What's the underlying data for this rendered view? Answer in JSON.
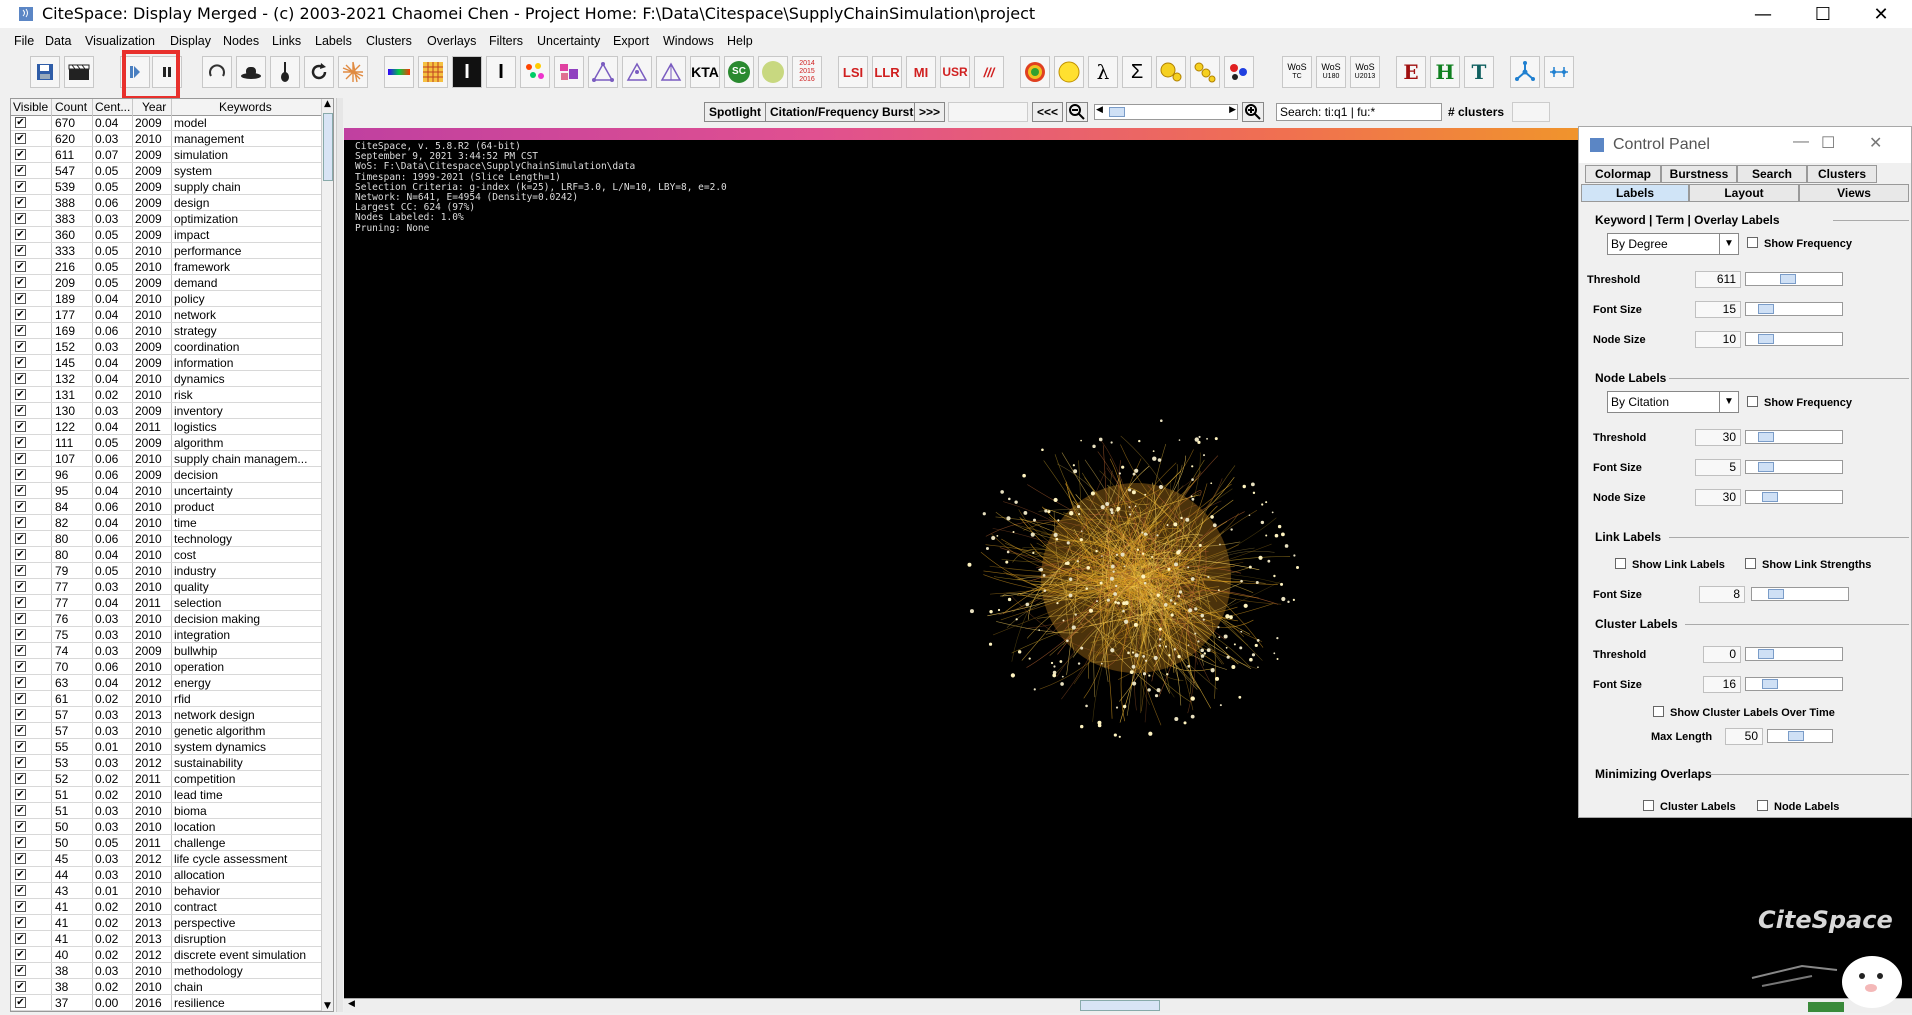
{
  "window": {
    "title": "CiteSpace: Display Merged - (c) 2003-2021 Chaomei Chen - Project Home: F:\\Data\\Citespace\\SupplyChainSimulation\\project",
    "minimize": "—",
    "maximize": "☐",
    "close": "✕"
  },
  "menu": [
    "File",
    "Data",
    "Visualization",
    "Display",
    "Nodes",
    "Links",
    "Labels",
    "Clusters",
    "Overlays",
    "Filters",
    "Uncertainty",
    "Export",
    "Windows",
    "Help"
  ],
  "toolbar": {
    "save_icon": "floppy-icon",
    "film_icon": "clapper-icon",
    "play_icon": "play-icon",
    "pause_icon": "pause-icon",
    "lsi": "LSI",
    "llr": "LLR",
    "mi": "MI",
    "usr": "USR",
    "slashes": "///",
    "kta": "KTA",
    "sc": "SC",
    "years": [
      "2014",
      "2015",
      "2016"
    ],
    "lambda": "λ",
    "sigma": "Σ",
    "wos_tc": [
      "WoS",
      "TC"
    ],
    "wos_u180": [
      "WoS",
      "U180"
    ],
    "wos_u2013": [
      "WoS",
      "U2013"
    ],
    "e": "E",
    "h": "H",
    "t": "T"
  },
  "table": {
    "headers": [
      "Visible",
      "Count",
      "Cent...",
      "Year",
      "Keywords"
    ],
    "rows": [
      {
        "count": "670",
        "cent": "0.04",
        "year": "2009",
        "kw": "model"
      },
      {
        "count": "620",
        "cent": "0.03",
        "year": "2010",
        "kw": "management"
      },
      {
        "count": "611",
        "cent": "0.07",
        "year": "2009",
        "kw": "simulation"
      },
      {
        "count": "547",
        "cent": "0.05",
        "year": "2009",
        "kw": "system"
      },
      {
        "count": "539",
        "cent": "0.05",
        "year": "2009",
        "kw": "supply chain"
      },
      {
        "count": "388",
        "cent": "0.06",
        "year": "2009",
        "kw": "design"
      },
      {
        "count": "383",
        "cent": "0.03",
        "year": "2009",
        "kw": "optimization"
      },
      {
        "count": "360",
        "cent": "0.05",
        "year": "2009",
        "kw": "impact"
      },
      {
        "count": "333",
        "cent": "0.05",
        "year": "2010",
        "kw": "performance"
      },
      {
        "count": "216",
        "cent": "0.05",
        "year": "2010",
        "kw": "framework"
      },
      {
        "count": "209",
        "cent": "0.05",
        "year": "2009",
        "kw": "demand"
      },
      {
        "count": "189",
        "cent": "0.04",
        "year": "2010",
        "kw": "policy"
      },
      {
        "count": "177",
        "cent": "0.04",
        "year": "2010",
        "kw": "network"
      },
      {
        "count": "169",
        "cent": "0.06",
        "year": "2010",
        "kw": "strategy"
      },
      {
        "count": "152",
        "cent": "0.03",
        "year": "2009",
        "kw": "coordination"
      },
      {
        "count": "145",
        "cent": "0.04",
        "year": "2009",
        "kw": "information"
      },
      {
        "count": "132",
        "cent": "0.04",
        "year": "2010",
        "kw": "dynamics"
      },
      {
        "count": "131",
        "cent": "0.02",
        "year": "2010",
        "kw": "risk"
      },
      {
        "count": "130",
        "cent": "0.03",
        "year": "2009",
        "kw": "inventory"
      },
      {
        "count": "122",
        "cent": "0.04",
        "year": "2011",
        "kw": "logistics"
      },
      {
        "count": "111",
        "cent": "0.05",
        "year": "2009",
        "kw": "algorithm"
      },
      {
        "count": "107",
        "cent": "0.06",
        "year": "2010",
        "kw": "supply chain managem..."
      },
      {
        "count": "96",
        "cent": "0.06",
        "year": "2009",
        "kw": "decision"
      },
      {
        "count": "95",
        "cent": "0.04",
        "year": "2010",
        "kw": "uncertainty"
      },
      {
        "count": "84",
        "cent": "0.06",
        "year": "2010",
        "kw": "product"
      },
      {
        "count": "82",
        "cent": "0.04",
        "year": "2010",
        "kw": "time"
      },
      {
        "count": "80",
        "cent": "0.06",
        "year": "2010",
        "kw": "technology"
      },
      {
        "count": "80",
        "cent": "0.04",
        "year": "2010",
        "kw": "cost"
      },
      {
        "count": "79",
        "cent": "0.05",
        "year": "2010",
        "kw": "industry"
      },
      {
        "count": "77",
        "cent": "0.03",
        "year": "2010",
        "kw": "quality"
      },
      {
        "count": "77",
        "cent": "0.04",
        "year": "2011",
        "kw": "selection"
      },
      {
        "count": "76",
        "cent": "0.03",
        "year": "2010",
        "kw": "decision making"
      },
      {
        "count": "75",
        "cent": "0.03",
        "year": "2010",
        "kw": "integration"
      },
      {
        "count": "74",
        "cent": "0.03",
        "year": "2009",
        "kw": "bullwhip"
      },
      {
        "count": "70",
        "cent": "0.06",
        "year": "2010",
        "kw": "operation"
      },
      {
        "count": "63",
        "cent": "0.04",
        "year": "2012",
        "kw": "energy"
      },
      {
        "count": "61",
        "cent": "0.02",
        "year": "2010",
        "kw": "rfid"
      },
      {
        "count": "57",
        "cent": "0.03",
        "year": "2013",
        "kw": "network design"
      },
      {
        "count": "57",
        "cent": "0.03",
        "year": "2010",
        "kw": "genetic algorithm"
      },
      {
        "count": "55",
        "cent": "0.01",
        "year": "2010",
        "kw": "system dynamics"
      },
      {
        "count": "53",
        "cent": "0.03",
        "year": "2012",
        "kw": "sustainability"
      },
      {
        "count": "52",
        "cent": "0.02",
        "year": "2011",
        "kw": "competition"
      },
      {
        "count": "51",
        "cent": "0.02",
        "year": "2010",
        "kw": "lead time"
      },
      {
        "count": "51",
        "cent": "0.03",
        "year": "2010",
        "kw": "bioma"
      },
      {
        "count": "50",
        "cent": "0.03",
        "year": "2010",
        "kw": "location"
      },
      {
        "count": "50",
        "cent": "0.05",
        "year": "2011",
        "kw": "challenge"
      },
      {
        "count": "45",
        "cent": "0.03",
        "year": "2012",
        "kw": "life cycle assessment"
      },
      {
        "count": "44",
        "cent": "0.03",
        "year": "2010",
        "kw": "allocation"
      },
      {
        "count": "43",
        "cent": "0.01",
        "year": "2010",
        "kw": "behavior"
      },
      {
        "count": "41",
        "cent": "0.02",
        "year": "2010",
        "kw": "contract"
      },
      {
        "count": "41",
        "cent": "0.02",
        "year": "2013",
        "kw": "perspective"
      },
      {
        "count": "41",
        "cent": "0.02",
        "year": "2013",
        "kw": "disruption"
      },
      {
        "count": "40",
        "cent": "0.02",
        "year": "2012",
        "kw": "discrete event simulation"
      },
      {
        "count": "38",
        "cent": "0.03",
        "year": "2010",
        "kw": "methodology"
      },
      {
        "count": "38",
        "cent": "0.02",
        "year": "2010",
        "kw": "chain"
      },
      {
        "count": "37",
        "cent": "0.00",
        "year": "2016",
        "kw": "resilience"
      }
    ]
  },
  "vizbar": {
    "spotlight": "Spotlight",
    "burst": "Citation/Frequency Burst",
    "forward": ">>>",
    "back": "<<<",
    "search_value": "Search: ti:q1 | fu:*",
    "clusters_label": "# clusters"
  },
  "viz_info": [
    "CiteSpace, v. 5.8.R2 (64-bit)",
    "September 9, 2021 3:44:52 PM CST",
    "WoS: F:\\Data\\Citespace\\SupplyChainSimulation\\data",
    "Timespan: 1999-2021 (Slice Length=1)",
    "Selection Criteria: g-index (k=25), LRF=3.0, L/N=10, LBY=8, e=2.0",
    "Network: N=641, E=4954 (Density=0.0242)",
    "Largest CC: 624 (97%)",
    "Nodes Labeled: 1.0%",
    "Pruning: None"
  ],
  "control_panel": {
    "title": "Control Panel",
    "tabs_row1": [
      "Colormap",
      "Burstness",
      "Search",
      "Clusters"
    ],
    "tabs_row2": [
      "Labels",
      "Layout",
      "Views"
    ],
    "kw_section": "Keyword | Term | Overlay Labels",
    "kw_combo": "By Degree",
    "show_frequency": "Show Frequency",
    "threshold": "Threshold",
    "font_size": "Font Size",
    "node_size": "Node Size",
    "kw_threshold": "611",
    "kw_font": "15",
    "kw_node": "10",
    "node_section": "Node Labels",
    "node_combo": "By Citation",
    "n_threshold": "30",
    "n_font": "5",
    "n_node": "30",
    "link_section": "Link Labels",
    "show_link_labels": "Show Link Labels",
    "show_link_strengths": "Show Link Strengths",
    "l_font": "8",
    "cluster_section": "Cluster Labels",
    "c_threshold": "0",
    "c_font": "16",
    "show_cluster_over_time": "Show Cluster Labels Over Time",
    "max_length": "Max Length",
    "c_max": "50",
    "min_section": "Minimizing Overlaps",
    "cluster_labels": "Cluster Labels",
    "node_labels": "Node Labels"
  },
  "logo": "CiteSpace",
  "colors": {
    "highlight": "#e8302c",
    "viz_bg": "#000000",
    "accent": "#f0a020"
  }
}
